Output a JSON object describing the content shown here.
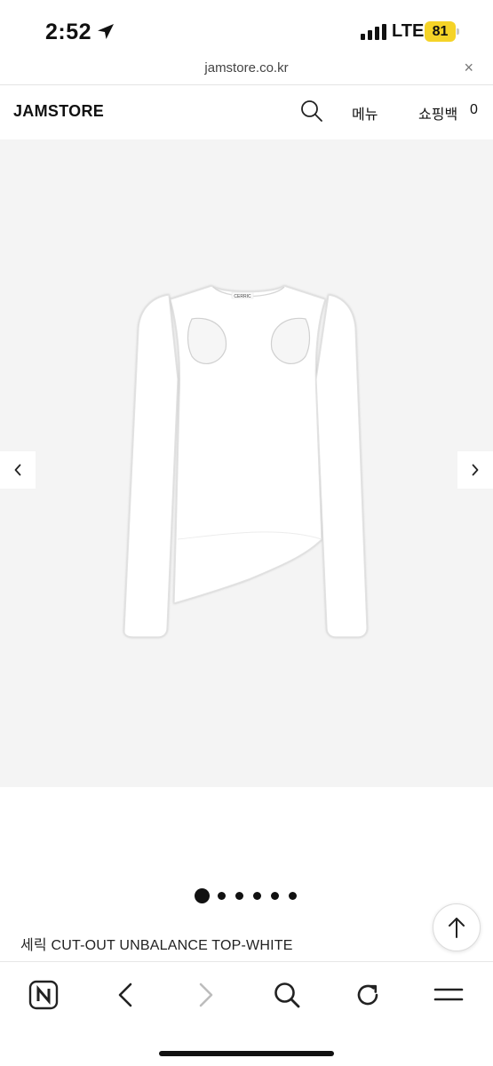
{
  "status_bar": {
    "time": "2:52",
    "network": "LTE",
    "battery": "81"
  },
  "browser": {
    "url": "jamstore.co.kr",
    "close_glyph": "×"
  },
  "header": {
    "logo": "JAMSTORE",
    "menu_label": "메뉴",
    "bag_label": "쇼핑백",
    "bag_count": "0"
  },
  "gallery": {
    "prev_glyph": "‹",
    "next_glyph": "›",
    "brand_tag": "CERRIC",
    "slide_count": 6,
    "active_slide": 1
  },
  "product": {
    "name": "세릭 CUT-OUT UNBALANCE TOP-WHITE"
  },
  "icons": [
    "location-arrow-icon",
    "signal-icon",
    "search-icon",
    "chevron-left-icon",
    "chevron-right-icon",
    "arrow-up-icon",
    "naver-home-icon",
    "back-icon",
    "forward-icon",
    "reload-icon",
    "hamburger-menu-icon"
  ]
}
